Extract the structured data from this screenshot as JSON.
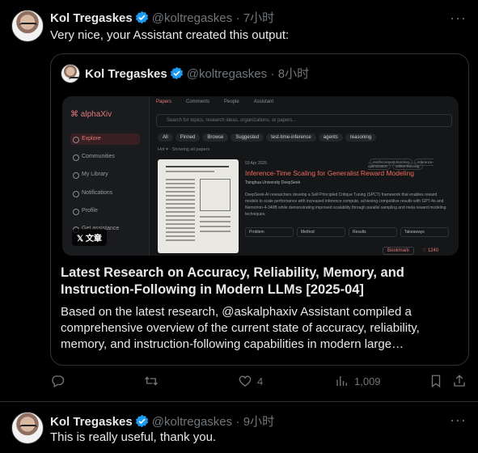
{
  "tweet1": {
    "name": "Kol Tregaskes",
    "handle": "@koltregaskes",
    "time": "· 7小时",
    "more": "···",
    "text": "Very nice, your Assistant created this output:"
  },
  "quote": {
    "name": "Kol Tregaskes",
    "handle": "@koltregaskes",
    "time": "· 8小时",
    "image": {
      "brand": "alphaXiv",
      "sidebar": [
        "Explore",
        "Communities",
        "My Library",
        "Notifications",
        "Profile",
        "Get assistance"
      ],
      "tabs": [
        "Papers",
        "Comments",
        "People",
        "Assistant"
      ],
      "search_placeholder": "Search for topics, research ideas, organizations, or papers...",
      "chips": [
        "All",
        "Pinned",
        "Browse",
        "Suggested",
        "test-time-inference",
        "agents",
        "reasoning"
      ],
      "filter_meta": "Hot ▾ · Showing all papers",
      "paper_date": "03 Apr 2025",
      "paper_title": "Inference-Time Scaling for Generalist Reward Modeling",
      "paper_tags": [
        "reinforcement-learning",
        "inference-optimization",
        "online-learning"
      ],
      "paper_orgs": "Tsinghua University   DeepSeek",
      "paper_abstract": "DeepSeek-AI researchers develop a Self-Principled Critique Tuning (SPCT) framework that enables reward models to scale performance with increased inference compute, achieving competitive results with GPT-4o and Nemotron-4-340B while demonstrating improved scalability through parallel sampling and meta reward modeling techniques.",
      "filters": [
        "Problem",
        "Method",
        "Results",
        "Takeaways"
      ],
      "bookmark": "Bookmark",
      "likes": "1240",
      "badge": "𝕏 文章"
    },
    "title": "Latest Research on Accuracy, Reliability, Memory, and Instruction-Following in Modern LLMs [2025-04]",
    "description": "Based on the latest research, @askalphaxiv Assistant compiled a comprehensive overview of the current state of accuracy, reliability, memory, and instruction-following capabilities in modern large…"
  },
  "actions": {
    "reply_count": "",
    "retweet_count": "",
    "like_count": "4",
    "views": "1,009"
  },
  "tweet2": {
    "name": "Kol Tregaskes",
    "handle": "@koltregaskes",
    "time": "· 9小时",
    "more": "···",
    "text": "This is really useful, thank you."
  },
  "colors": {
    "verified": "#1d9bf0",
    "accent": "#ef6b5b"
  }
}
